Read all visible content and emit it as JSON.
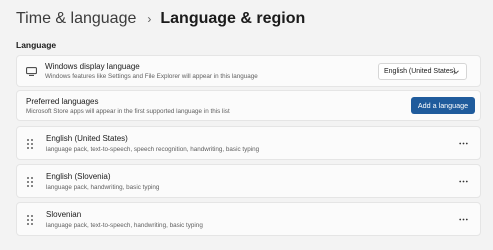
{
  "header": {
    "parent": "Time & language",
    "separator": "›",
    "current": "Language & region"
  },
  "section": {
    "title": "Language"
  },
  "display_language": {
    "title": "Windows display language",
    "subtitle": "Windows features like Settings and File Explorer will appear in this language",
    "selected": "English (United States)",
    "icon": "monitor-icon"
  },
  "preferred": {
    "title": "Preferred languages",
    "subtitle": "Microsoft Store apps will appear in the first supported language in this list",
    "add_label": "Add a language"
  },
  "languages": [
    {
      "name": "English (United States)",
      "features": "language pack, text-to-speech, speech recognition, handwriting, basic typing"
    },
    {
      "name": "English (Slovenia)",
      "features": "language pack, handwriting, basic typing"
    },
    {
      "name": "Slovenian",
      "features": "language pack, text-to-speech, handwriting, basic typing"
    }
  ],
  "colors": {
    "accent": "#1f5b9c",
    "background": "#f3f3f3",
    "card": "#fbfbfb"
  }
}
